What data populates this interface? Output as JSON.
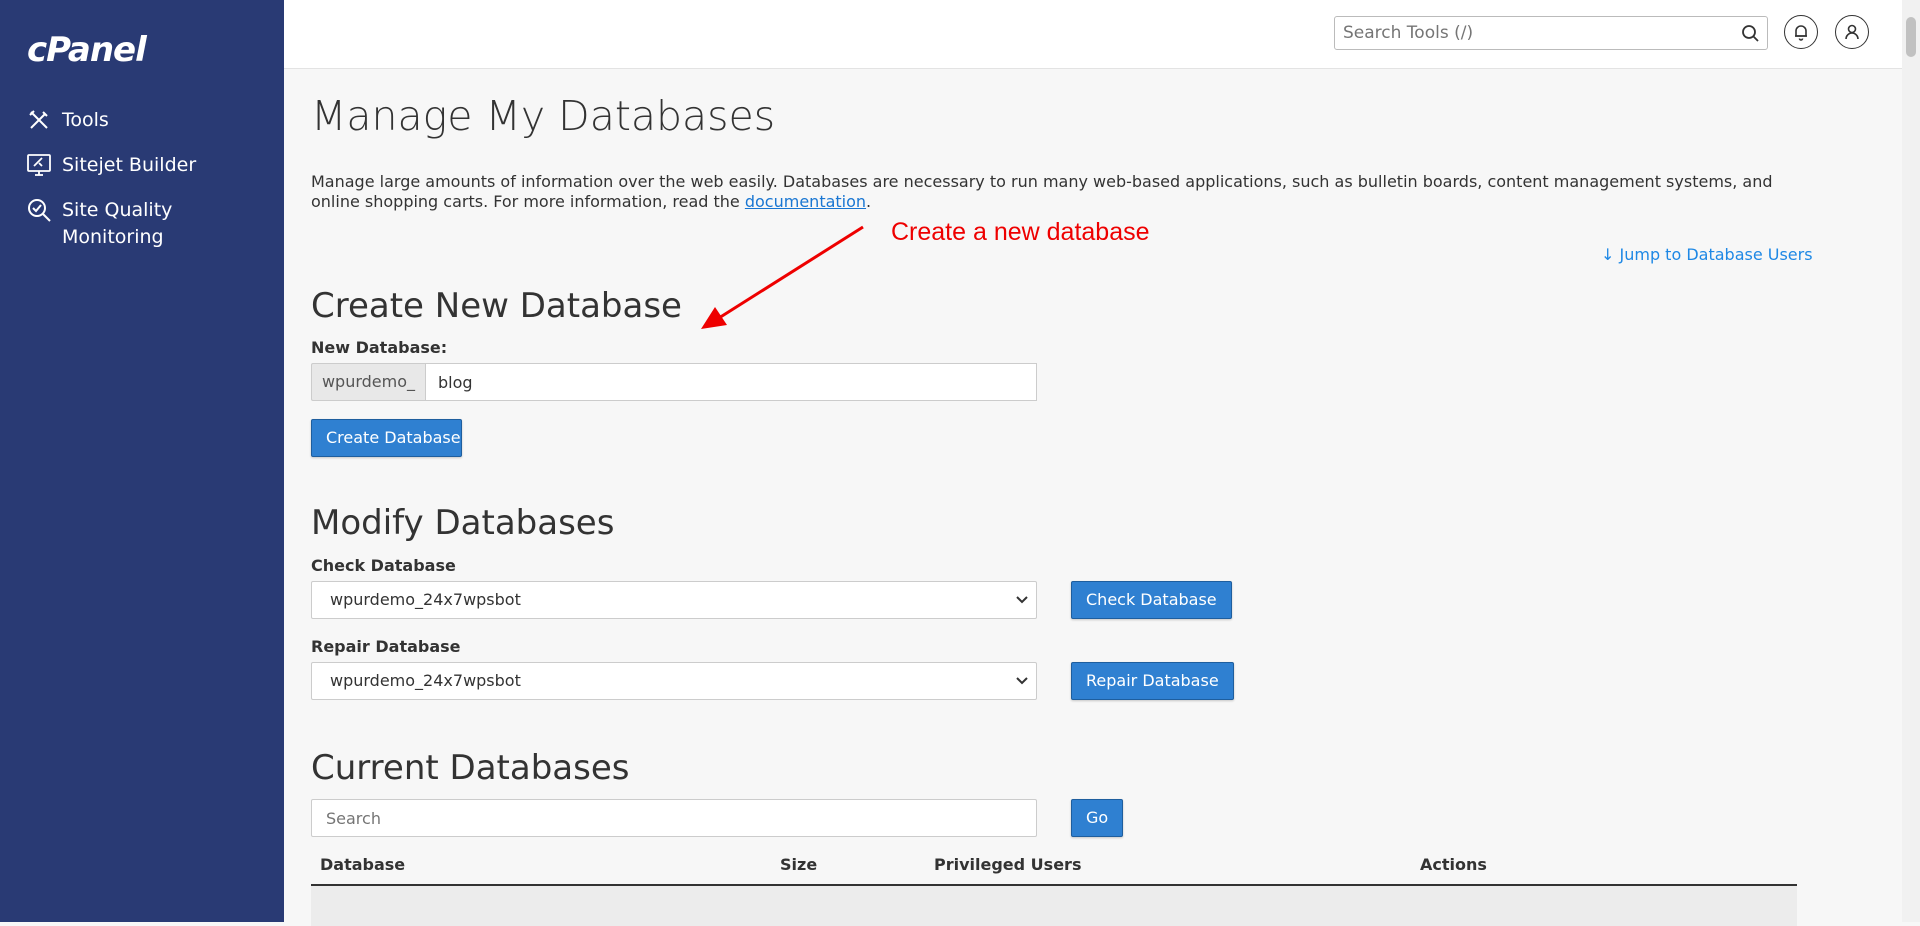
{
  "sidebar": {
    "logo": "cPanel",
    "items": [
      {
        "label": "Tools",
        "icon": "tools-icon"
      },
      {
        "label": "Sitejet Builder",
        "icon": "sitejet-icon"
      },
      {
        "label_line1": "Site Quality",
        "label_line2": "Monitoring",
        "icon": "site-quality-icon"
      }
    ]
  },
  "header": {
    "search_placeholder": "Search Tools (/)"
  },
  "page": {
    "title": "Manage My Databases",
    "intro_text": "Manage large amounts of information over the web easily. Databases are necessary to run many web-based applications, such as bulletin boards, content management systems, and online shopping carts. For more information, read the ",
    "intro_link": "documentation",
    "intro_end": ".",
    "jump_link": "↓ Jump to Database Users",
    "annotation": "Create a new database"
  },
  "create": {
    "heading": "Create New Database",
    "label": "New Database:",
    "prefix": "wpurdemo_",
    "value": "blog",
    "button": "Create Database"
  },
  "modify": {
    "heading": "Modify Databases",
    "check_label": "Check Database",
    "check_value": "wpurdemo_24x7wpsbot",
    "check_button": "Check Database",
    "repair_label": "Repair Database",
    "repair_value": "wpurdemo_24x7wpsbot",
    "repair_button": "Repair Database"
  },
  "current": {
    "heading": "Current Databases",
    "search_placeholder": "Search",
    "go_button": "Go",
    "columns": [
      "Database",
      "Size",
      "Privileged Users",
      "Actions"
    ]
  },
  "colors": {
    "sidebar_bg": "#293a74",
    "button_bg": "#2f80d1",
    "annotation": "#ee0000",
    "link": "#1e88e5"
  }
}
